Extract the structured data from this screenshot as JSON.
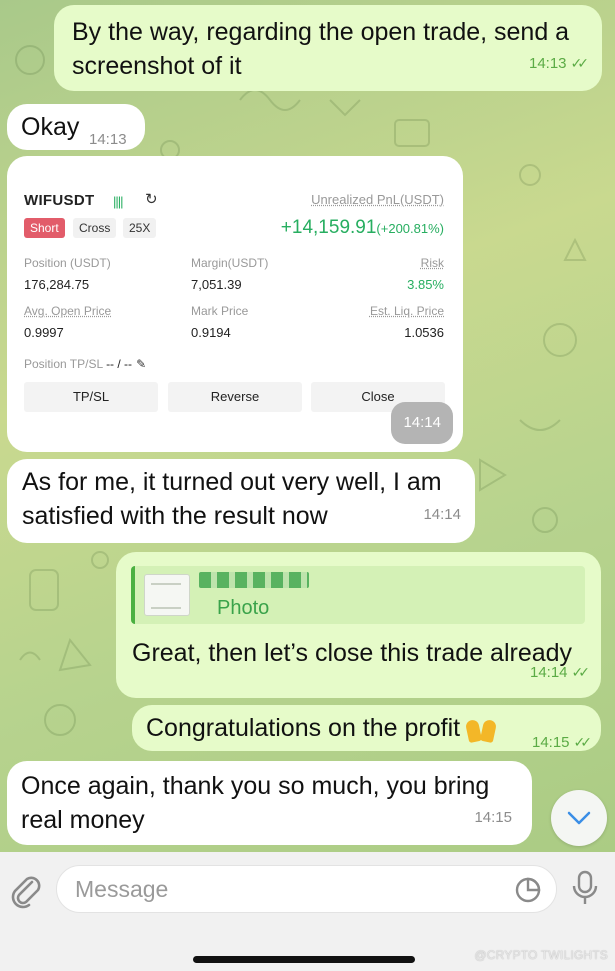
{
  "colors": {
    "outgoing_bubble": "#e6fbc9",
    "incoming_bubble": "#ffffff",
    "accent_green": "#5bab45",
    "profit_green": "#27ae60",
    "short_red": "#e25c6a"
  },
  "messages": [
    {
      "direction": "outgoing",
      "text": "By the way, regarding the open trade, send a screenshot of it",
      "time": "14:13",
      "read": true
    },
    {
      "direction": "incoming",
      "text": "Okay",
      "time": "14:13"
    },
    {
      "direction": "incoming",
      "type": "photo",
      "time": "14:14"
    },
    {
      "direction": "incoming",
      "text": "As for me, it turned out very well, I am satisfied with the result now",
      "time": "14:14"
    },
    {
      "direction": "outgoing",
      "reply_to": {
        "label": "Photo"
      },
      "text": "Great, then let’s close this trade already",
      "time": "14:14",
      "read": true
    },
    {
      "direction": "outgoing",
      "text": "Congratulations on the profit",
      "emoji": "raising-hands",
      "time": "14:15",
      "read": true
    },
    {
      "direction": "incoming",
      "text": "Once again, thank you so much, you bring real money",
      "time": "14:15"
    }
  ],
  "trade_card": {
    "symbol": "WIFUSDT",
    "side": "Short",
    "margin_mode": "Cross",
    "leverage": "25X",
    "unrealized_pnl_label": "Unrealized PnL(USDT)",
    "unrealized_pnl_value": "+14,159.91",
    "unrealized_pnl_pct": "(+200.81%)",
    "position_label": "Position (USDT)",
    "position_value": "176,284.75",
    "margin_label": "Margin(USDT)",
    "margin_value": "7,051.39",
    "risk_label": "Risk",
    "risk_value": "3.85%",
    "avg_open_label": "Avg. Open Price",
    "avg_open_value": "0.9997",
    "mark_price_label": "Mark Price",
    "mark_price_value": "0.9194",
    "liq_price_label": "Est. Liq. Price",
    "liq_price_value": "1.0536",
    "tpsl_label": "Position TP/SL",
    "tpsl_value": "-- / --",
    "buttons": [
      "TP/SL",
      "Reverse",
      "Close"
    ]
  },
  "input": {
    "placeholder": "Message"
  },
  "watermark": "@CRYPTO TWILIGHTS"
}
